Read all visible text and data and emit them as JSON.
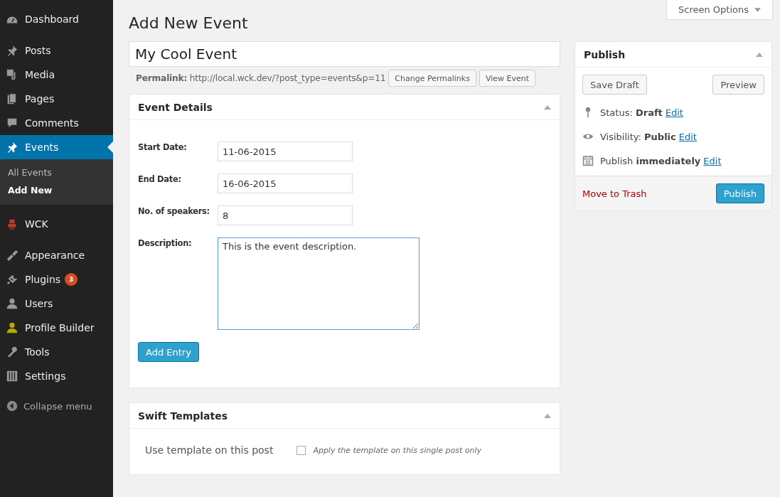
{
  "sidebar": {
    "groups": [
      {
        "items": [
          {
            "label": "Dashboard",
            "selected": false
          }
        ]
      },
      {
        "items": [
          {
            "label": "Posts",
            "selected": false
          },
          {
            "label": "Media",
            "selected": false
          },
          {
            "label": "Pages",
            "selected": false
          },
          {
            "label": "Comments",
            "selected": false
          },
          {
            "label": "Events",
            "selected": true,
            "submenu": [
              {
                "label": "All Events",
                "selected": false
              },
              {
                "label": "Add New",
                "selected": true
              }
            ]
          }
        ]
      },
      {
        "items": [
          {
            "label": "WCK",
            "selected": false
          }
        ]
      },
      {
        "items": [
          {
            "label": "Appearance",
            "selected": false
          },
          {
            "label": "Plugins",
            "selected": false,
            "badge": "3"
          },
          {
            "label": "Users",
            "selected": false
          },
          {
            "label": "Profile Builder",
            "selected": false
          },
          {
            "label": "Tools",
            "selected": false
          },
          {
            "label": "Settings",
            "selected": false
          }
        ]
      }
    ],
    "collapse": "Collapse menu"
  },
  "screen_options": "Screen Options",
  "page_title": "Add New Event",
  "post_title": "My Cool Event",
  "permalink": {
    "label": "Permalink:",
    "url": "http://local.wck.dev/?post_type=events&p=11",
    "buttons": [
      "Change Permalinks",
      "View Event"
    ]
  },
  "event_details": {
    "title": "Event Details",
    "fields": [
      {
        "label": "Start Date:",
        "value": "11-06-2015",
        "kind": "input"
      },
      {
        "label": "End Date:",
        "value": "16-06-2015",
        "kind": "input"
      },
      {
        "label": "No. of speakers:",
        "value": "8",
        "kind": "input"
      },
      {
        "label": "Description:",
        "value": "This is the event description.",
        "kind": "textarea"
      }
    ],
    "button": "Add Entry"
  },
  "swift_templates": {
    "title": "Swift Templates",
    "label": "Use template on this post",
    "checkbox": {
      "label": "Apply the template on this single post only",
      "checked": false
    }
  },
  "publish": {
    "title": "Publish",
    "save_draft": "Save Draft",
    "preview": "Preview",
    "rows": [
      {
        "text": "Status: **Draft**",
        "link": "Edit"
      },
      {
        "text": "Visibility: **Public**",
        "link": "Edit"
      },
      {
        "text": "Publish **immediately**",
        "link": "Edit"
      }
    ],
    "trash": "Move to Trash",
    "publish_button": "Publish"
  }
}
